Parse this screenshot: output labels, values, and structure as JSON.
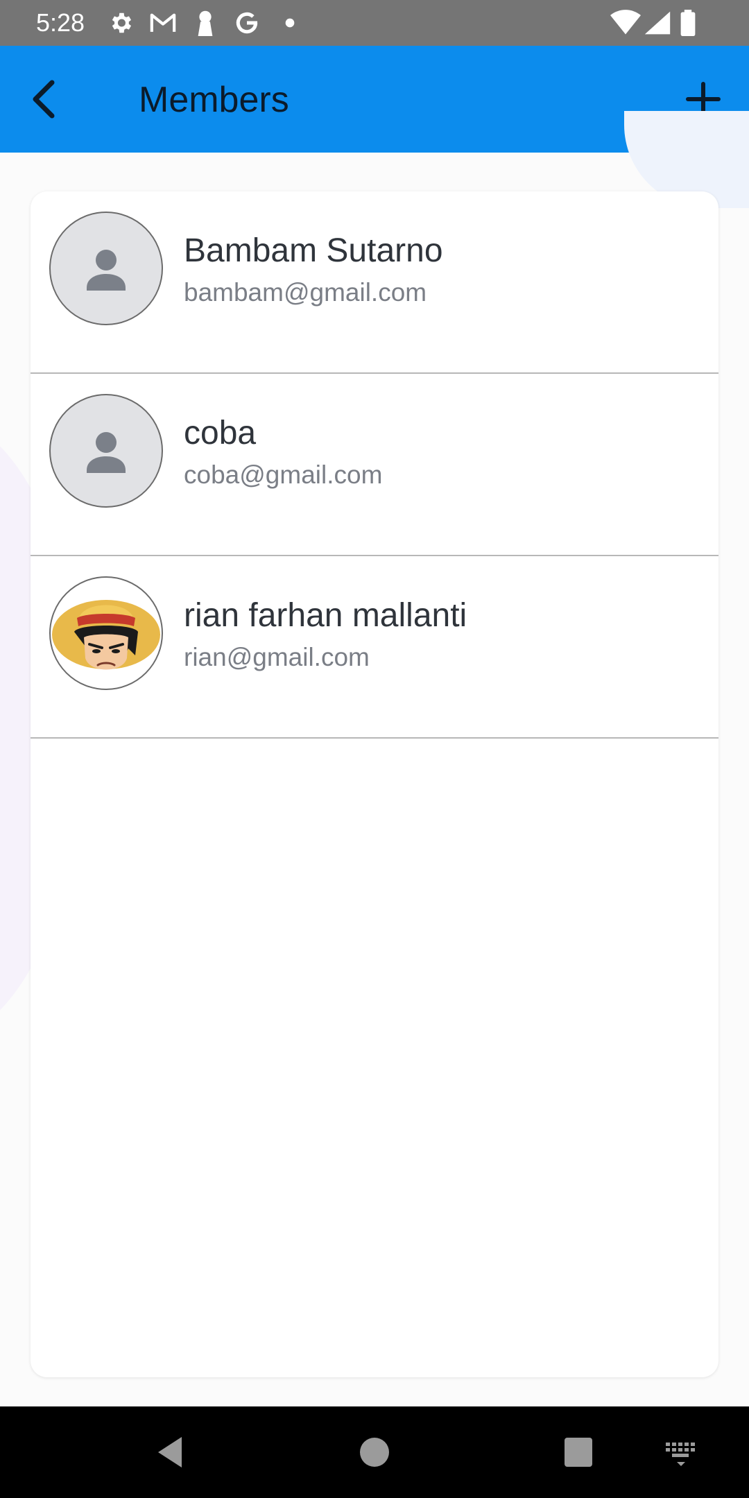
{
  "status_bar": {
    "time": "5:28",
    "left_icons": [
      "gear-icon",
      "gmail-icon",
      "keyhole-icon",
      "google-icon",
      "dot-icon"
    ],
    "right_icons": [
      "wifi-icon",
      "signal-icon",
      "battery-icon"
    ]
  },
  "app_bar": {
    "title": "Members",
    "back_icon": "chevron-left-icon",
    "add_icon": "plus-icon",
    "background_color": "#0c8ced"
  },
  "members": [
    {
      "name": "Bambam Sutarno",
      "email": "bambam@gmail.com",
      "avatar": "default-person-icon"
    },
    {
      "name": "coba",
      "email": "coba@gmail.com",
      "avatar": "default-person-icon"
    },
    {
      "name": "rian farhan mallanti",
      "email": "rian@gmail.com",
      "avatar": "anime-character-photo"
    }
  ],
  "nav_bar": {
    "buttons": [
      "back-triangle-icon",
      "home-circle-icon",
      "recents-square-icon",
      "keyboard-icon"
    ]
  }
}
